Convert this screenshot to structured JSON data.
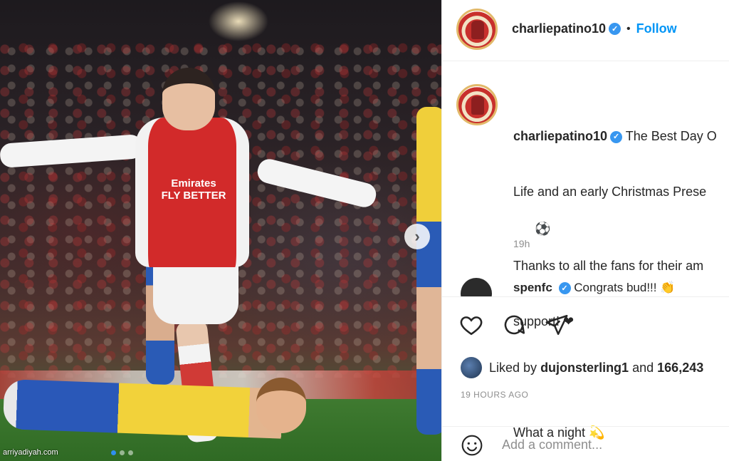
{
  "photo": {
    "shirt_sponsor": "Emirates\nFLY BETTER",
    "watermark": "arriyadiyah.com",
    "carousel_dots": 3,
    "active_dot": 0
  },
  "header": {
    "username": "charliepatino10",
    "separator": "•",
    "follow_label": "Follow"
  },
  "caption": {
    "username": "charliepatino10",
    "line1": "The Best Day O",
    "line2": "Life and an early Christmas Prese",
    "line3": "⚽",
    "line4": "Thanks to all the fans for their am",
    "line5": "support! ❤",
    "line6": "",
    "line7": "What a night 💫",
    "time": "19h"
  },
  "comment": {
    "username": "spenfc",
    "text": "Congrats bud!!! 👏"
  },
  "likes": {
    "prefix": "Liked by",
    "user": "dujonsterling1",
    "and": "and",
    "count": "166,243"
  },
  "timestamp": "19 HOURS AGO",
  "add_comment": {
    "placeholder": "Add a comment..."
  },
  "colors": {
    "follow": "#0095f6",
    "verified": "#3897f0",
    "muted": "#8e8e8e"
  },
  "icons": [
    "heart-icon",
    "comment-icon",
    "share-icon",
    "smile-icon",
    "verified-icon",
    "chevron-right-icon"
  ]
}
